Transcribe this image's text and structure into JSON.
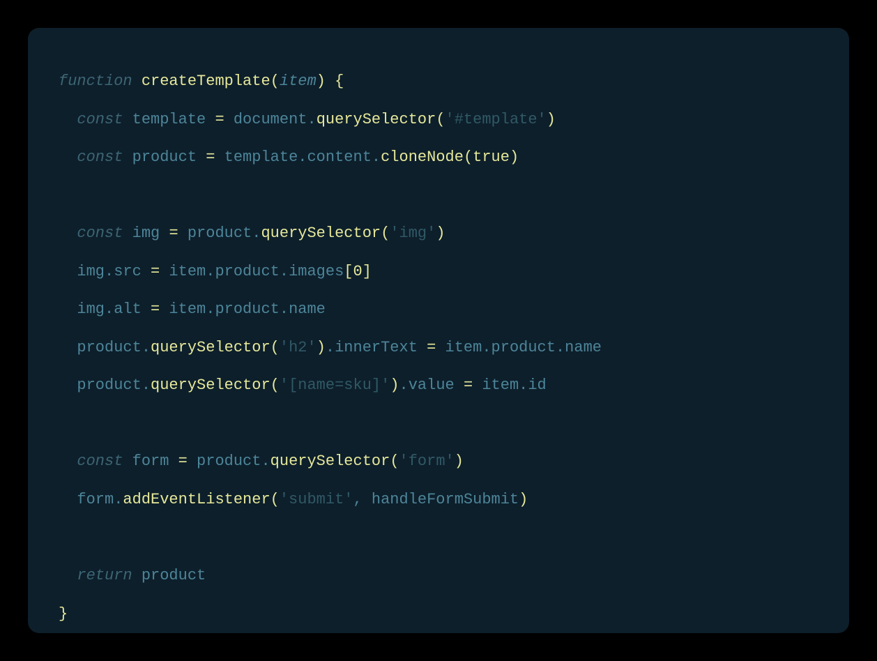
{
  "code": {
    "line1": {
      "kw_function": "function",
      "fn_name": "createTemplate",
      "paren_open": "(",
      "param": "item",
      "paren_close": ")",
      "brace_open": " {"
    },
    "line2": {
      "kw_const": "const",
      "var": " template ",
      "eq": "=",
      "obj": " document",
      "dot": ".",
      "method": "querySelector",
      "paren_open": "(",
      "str": "'#template'",
      "paren_close": ")"
    },
    "line3": {
      "kw_const": "const",
      "var": " product ",
      "eq": "=",
      "obj": " template",
      "dot1": ".",
      "prop": "content",
      "dot2": ".",
      "method": "cloneNode",
      "paren_open": "(",
      "bool": "true",
      "paren_close": ")"
    },
    "line5": {
      "kw_const": "const",
      "var": " img ",
      "eq": "=",
      "obj": " product",
      "dot": ".",
      "method": "querySelector",
      "paren_open": "(",
      "str": "'img'",
      "paren_close": ")"
    },
    "line6": {
      "obj": "img",
      "dot1": ".",
      "prop1": "src ",
      "eq": "=",
      "obj2": " item",
      "dot2": ".",
      "prop2": "product",
      "dot3": ".",
      "prop3": "images",
      "bracket_open": "[",
      "num": "0",
      "bracket_close": "]"
    },
    "line7": {
      "obj": "img",
      "dot1": ".",
      "prop1": "alt ",
      "eq": "=",
      "obj2": " item",
      "dot2": ".",
      "prop2": "product",
      "dot3": ".",
      "prop3": "name"
    },
    "line8": {
      "obj": "product",
      "dot1": ".",
      "method": "querySelector",
      "paren_open": "(",
      "str": "'h2'",
      "paren_close": ")",
      "dot2": ".",
      "prop1": "innerText ",
      "eq": "=",
      "obj2": " item",
      "dot3": ".",
      "prop2": "product",
      "dot4": ".",
      "prop3": "name"
    },
    "line9": {
      "obj": "product",
      "dot1": ".",
      "method": "querySelector",
      "paren_open": "(",
      "str": "'[name=sku]'",
      "paren_close": ")",
      "dot2": ".",
      "prop1": "value ",
      "eq": "=",
      "obj2": " item",
      "dot3": ".",
      "prop2": "id"
    },
    "line11": {
      "kw_const": "const",
      "var": " form ",
      "eq": "=",
      "obj": " product",
      "dot": ".",
      "method": "querySelector",
      "paren_open": "(",
      "str": "'form'",
      "paren_close": ")"
    },
    "line12": {
      "obj": "form",
      "dot": ".",
      "method": "addEventListener",
      "paren_open": "(",
      "str": "'submit'",
      "comma": ", ",
      "arg": "handleFormSubmit",
      "paren_close": ")"
    },
    "line14": {
      "kw_return": "return",
      "var": " product"
    },
    "line15": {
      "brace_close": "}"
    }
  }
}
